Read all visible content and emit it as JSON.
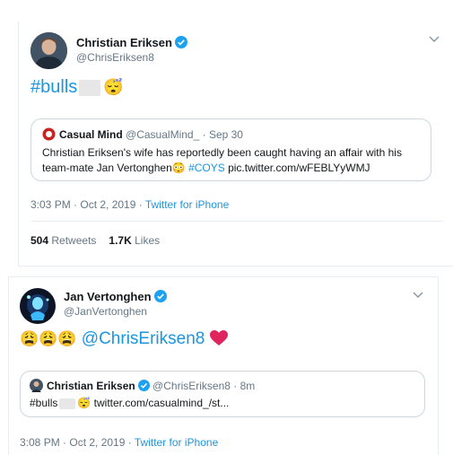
{
  "tweet1": {
    "author_name": "Christian Eriksen",
    "author_handle": "@ChrisEriksen8",
    "text_hashtag": "#bulls",
    "text_emoji": "😴",
    "quote": {
      "avatar_icon": "circle-logo-icon",
      "author_name": "Casual Mind",
      "author_handle": "@CasualMind_",
      "dot": "·",
      "date": "Sep 30",
      "text_line1": "Christian Eriksen's wife has reportedly been caught having an affair with his",
      "text_line2_plain": "team-mate Jan Vertonghen",
      "text_line2_emoji": "😳",
      "text_line2_hashtag": "#COYS",
      "text_line2_link": "pic.twitter.com/wFEBLYyWMJ"
    },
    "timestamp": "3:03 PM · Oct 2, 2019",
    "dot": "·",
    "source": "Twitter for iPhone",
    "retweets_count": "504",
    "retweets_label": "Retweets",
    "likes_count": "1.7K",
    "likes_label": "Likes"
  },
  "tweet2": {
    "author_name": "Jan Vertonghen",
    "author_handle": "@JanVertonghen",
    "text_emojis": "😩😩😩",
    "text_mention": "@ChrisEriksen8",
    "text_heart": "❤️",
    "quote": {
      "author_name": "Christian Eriksen",
      "author_handle": "@ChrisEriksen8",
      "dot": "·",
      "time": "8m",
      "text_hashtag": "#bulls",
      "text_emoji": "😴",
      "text_link": "twitter.com/casualmind_/st..."
    },
    "timestamp": "3:08 PM · Oct 2, 2019",
    "dot": "·",
    "source": "Twitter for iPhone"
  },
  "colors": {
    "accent": "#1b95e0",
    "verified": "#1da1f2",
    "muted": "#657786",
    "border": "#e6ecf0",
    "heart": "#e0245e"
  },
  "icons": [
    "verified-badge-icon",
    "chevron-down-icon",
    "heart-icon"
  ]
}
